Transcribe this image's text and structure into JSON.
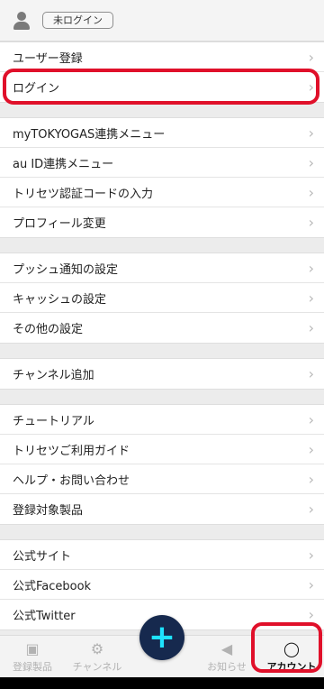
{
  "header": {
    "status": "未ログイン"
  },
  "groups": [
    [
      "ユーザー登録",
      "ログイン"
    ],
    [
      "myTOKYOGAS連携メニュー",
      "au ID連携メニュー",
      "トリセツ認証コードの入力",
      "プロフィール変更"
    ],
    [
      "プッシュ通知の設定",
      "キャッシュの設定",
      "その他の設定"
    ],
    [
      "チャンネル追加"
    ],
    [
      "チュートリアル",
      "トリセツご利用ガイド",
      "ヘルプ・お問い合わせ",
      "登録対象製品"
    ],
    [
      "公式サイト",
      "公式Facebook",
      "公式Twitter"
    ]
  ],
  "tabs": [
    {
      "label": "登録製品",
      "icon": "registered-products-icon"
    },
    {
      "label": "チャンネル",
      "icon": "channel-icon"
    },
    {
      "label": "お知らせ",
      "icon": "megaphone-icon"
    },
    {
      "label": "アカウント",
      "icon": "account-icon"
    }
  ],
  "fab": {
    "symbol": "+"
  },
  "chevron": "›",
  "colors": {
    "highlight": "#e0102a",
    "fab_bg": "#16294e",
    "fab_plus": "#1ee3ff"
  }
}
